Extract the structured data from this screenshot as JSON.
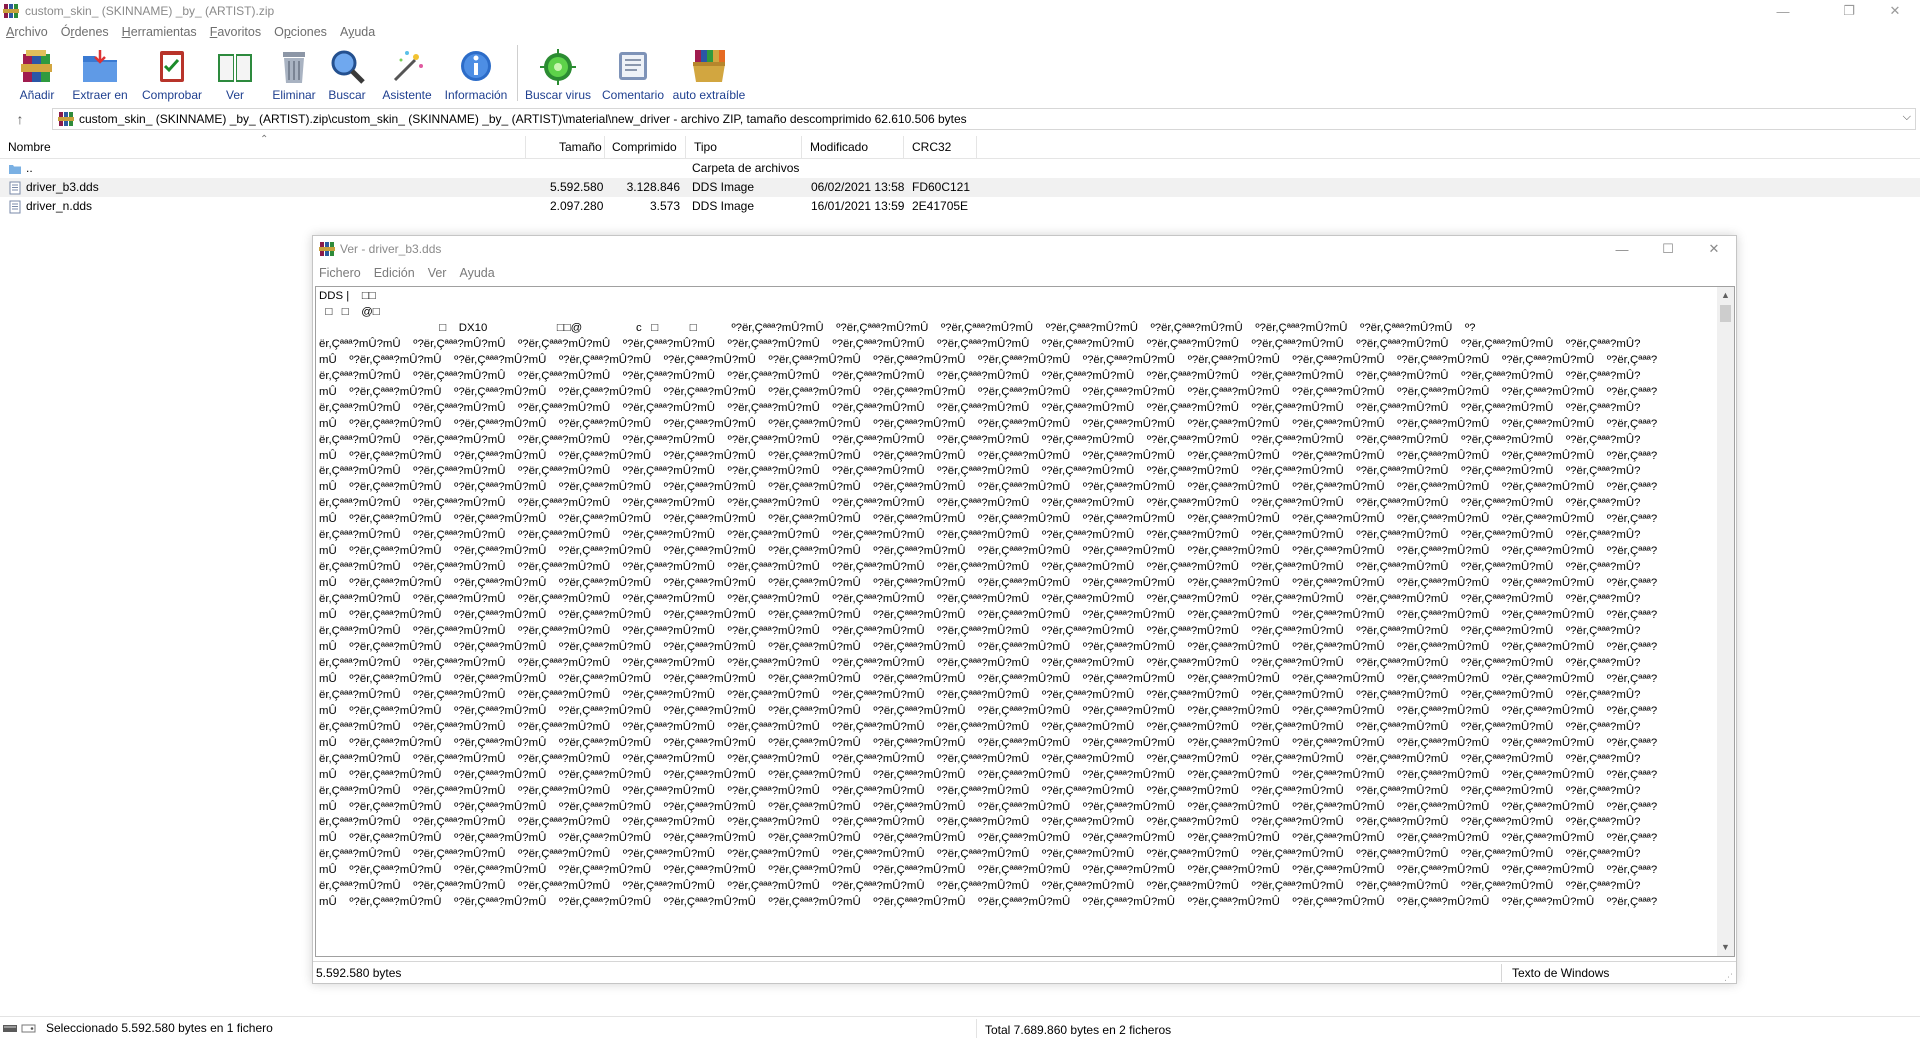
{
  "window": {
    "title": "custom_skin_ (SKINNAME) _by_ (ARTIST).zip",
    "controls": [
      "minimize",
      "restore",
      "close"
    ]
  },
  "menubar": [
    {
      "label": "Archivo",
      "mnemonic": "A"
    },
    {
      "label": "Órdenes",
      "mnemonic": "r"
    },
    {
      "label": "Herramientas",
      "mnemonic": "H"
    },
    {
      "label": "Favoritos",
      "mnemonic": "F"
    },
    {
      "label": "Opciones",
      "mnemonic": "p"
    },
    {
      "label": "Ayuda",
      "mnemonic": "y"
    }
  ],
  "toolbar": [
    {
      "label": "Añadir",
      "icon": "add-books-icon"
    },
    {
      "label": "Extraer en",
      "icon": "extract-folder-icon"
    },
    {
      "label": "Comprobar",
      "icon": "test-clipboard-icon"
    },
    {
      "label": "Ver",
      "icon": "view-book-icon"
    },
    {
      "label": "Eliminar",
      "icon": "trash-icon"
    },
    {
      "label": "Buscar",
      "icon": "magnifier-icon"
    },
    {
      "label": "Asistente",
      "icon": "wizard-wand-icon"
    },
    {
      "label": "Información",
      "icon": "info-icon"
    },
    {
      "label": "Buscar virus",
      "icon": "virus-scan-icon"
    },
    {
      "label": "Comentario",
      "icon": "comment-icon"
    },
    {
      "label": "auto extraíble",
      "icon": "sfx-icon"
    }
  ],
  "address": {
    "path": "custom_skin_ (SKINNAME) _by_ (ARTIST).zip\\custom_skin_ (SKINNAME) _by_ (ARTIST)\\material\\new_driver - archivo ZIP, tamaño descomprimido 62.610.506 bytes"
  },
  "filelist": {
    "columns": [
      "Nombre",
      "Tamaño",
      "Comprimido",
      "Tipo",
      "Modificado",
      "CRC32"
    ],
    "rows": [
      {
        "name": "..",
        "size": "",
        "packed": "",
        "type": "Carpeta de archivos",
        "modified": "",
        "crc": "",
        "selected": false,
        "icon": "folder-icon"
      },
      {
        "name": "driver_b3.dds",
        "size": "5.592.580",
        "packed": "3.128.846",
        "type": "DDS Image",
        "modified": "06/02/2021 13:58",
        "crc": "FD60C121",
        "selected": true,
        "icon": "file-icon"
      },
      {
        "name": "driver_n.dds",
        "size": "2.097.280",
        "packed": "3.573",
        "type": "DDS Image",
        "modified": "16/01/2021 13:59",
        "crc": "2E41705E",
        "selected": false,
        "icon": "file-icon"
      }
    ]
  },
  "viewer": {
    "title": "Ver - driver_b3.dds",
    "menu": [
      "Fichero",
      "Edición",
      "Ver",
      "Ayuda"
    ],
    "text_lines": [
      "DDS |    □□",
      "  □   □    @□",
      "                                      □    DX10                      □□@                 c   □          □           º?ër,Çªªª?mÛ?mÛ    º?ër,Çªªª?mÛ?mÛ    º?ër,Çªªª?mÛ?mÛ    º?ër,Çªªª?mÛ?mÛ    º?ër,Çªªª?mÛ?mÛ    º?ër,Çªªª?mÛ?mÛ    º?ër,Çªªª?mÛ?mÛ    º?",
      "ër,Çªªª?mÛ?mÛ    º?ër,Çªªª?mÛ?mÛ    º?ër,Çªªª?mÛ?mÛ    º?ër,Çªªª?mÛ?mÛ    º?ër,Çªªª?mÛ?mÛ    º?ër,Çªªª?mÛ?mÛ    º?ër,Çªªª?mÛ?mÛ    º?ër,Çªªª?mÛ?mÛ    º?ër,Çªªª?mÛ?mÛ    º?ër,Çªªª?mÛ?mÛ    º?ër,Çªªª?mÛ?mÛ    º?ër,Çªªª?mÛ?mÛ    º?ër,Çªªª?mÛ?",
      "mÛ    º?ër,Çªªª?mÛ?mÛ    º?ër,Çªªª?mÛ?mÛ    º?ër,Çªªª?mÛ?mÛ    º?ër,Çªªª?mÛ?mÛ    º?ër,Çªªª?mÛ?mÛ    º?ër,Çªªª?mÛ?mÛ    º?ër,Çªªª?mÛ?mÛ    º?ër,Çªªª?mÛ?mÛ    º?ër,Çªªª?mÛ?mÛ    º?ër,Çªªª?mÛ?mÛ    º?ër,Çªªª?mÛ?mÛ    º?ër,Çªªª?mÛ?mÛ    º?ër,Çªªª?"
    ],
    "filler_lines": 36,
    "status_bytes": "5.592.580 bytes",
    "encoding": "Texto de Windows"
  },
  "statusbar": {
    "left": "Seleccionado 5.592.580 bytes en 1 fichero",
    "right": "Total 7.689.860 bytes en 2 ficheros"
  },
  "colors": {
    "toolbar_label": "#1e3f8f",
    "selected_row": "#f1f1f1"
  }
}
